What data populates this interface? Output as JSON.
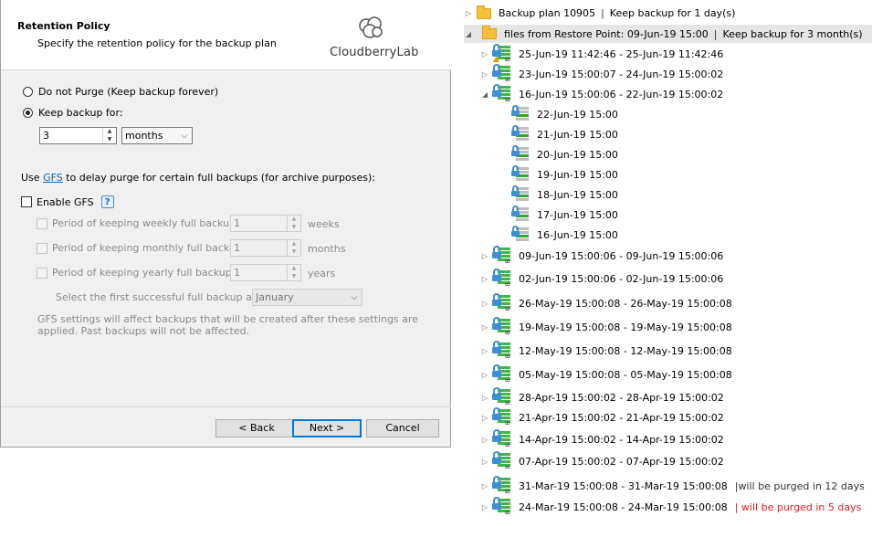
{
  "wizard": {
    "title": "Retention Policy",
    "subtitle": "Specify the retention policy for the backup plan",
    "logo_text": "CloudberryLab",
    "do_not_purge_label": "Do not Purge (Keep backup forever)",
    "keep_backup_label": "Keep backup for:",
    "keep_value": "3",
    "keep_unit": "months",
    "gfs_text_prefix": "Use",
    "gfs_link": "GFS",
    "gfs_text_suffix": "to delay purge for certain full backups (for archive purposes):",
    "enable_gfs_label": "Enable GFS",
    "help_glyph": "?",
    "weekly_label": "Period of keeping weekly full backups:",
    "weekly_value": "1",
    "weekly_unit": "weeks",
    "monthly_label": "Period of keeping monthly full backups:",
    "monthly_value": "1",
    "monthly_unit": "months",
    "yearly_label": "Period of keeping yearly full backups:",
    "yearly_value": "1",
    "yearly_unit": "years",
    "first_backup_label": "Select the first successful full backup as of:",
    "first_backup_value": "January",
    "note": "GFS settings will affect backups that will be created after these settings are applied. Past backups will not be affected.",
    "back_label": "< Back",
    "next_label": "Next >",
    "cancel_label": "Cancel"
  },
  "tree": {
    "plan": {
      "name": "Backup plan 10905",
      "keep": "Keep backup for 1 day(s)"
    },
    "restore_point": {
      "name": "files from Restore Point: 09-Jun-19 15:00",
      "keep": "Keep backup for 3 month(s)"
    },
    "ranges_top": [
      {
        "label": "25-Jun-19 11:42:46 - 25-Jun-19 11:42:46",
        "warn": true
      },
      {
        "label": "23-Jun-19 15:00:07 - 24-Jun-19 15:00:02"
      },
      {
        "label": "16-Jun-19 15:00:06 - 22-Jun-19 15:00:02"
      }
    ],
    "files": [
      {
        "label": "22-Jun-19 15:00"
      },
      {
        "label": "21-Jun-19 15:00"
      },
      {
        "label": "20-Jun-19 15:00"
      },
      {
        "label": "19-Jun-19 15:00"
      },
      {
        "label": "18-Jun-19 15:00"
      },
      {
        "label": "17-Jun-19 15:00"
      },
      {
        "label": "16-Jun-19 15:00"
      }
    ],
    "ranges_bottom": [
      {
        "label": "09-Jun-19 15:00:06 - 09-Jun-19 15:00:06"
      },
      {
        "label": "02-Jun-19 15:00:06 - 02-Jun-19 15:00:06"
      },
      {
        "label": "26-May-19 15:00:08 - 26-May-19 15:00:08"
      },
      {
        "label": "19-May-19 15:00:08 - 19-May-19 15:00:08"
      },
      {
        "label": "12-May-19 15:00:08 - 12-May-19 15:00:08"
      },
      {
        "label": "05-May-19 15:00:08 - 05-May-19 15:00:08"
      },
      {
        "label": "28-Apr-19 15:00:02 - 28-Apr-19 15:00:02"
      },
      {
        "label": "21-Apr-19 15:00:02 - 21-Apr-19 15:00:02"
      },
      {
        "label": "14-Apr-19 15:00:02 - 14-Apr-19 15:00:02"
      },
      {
        "label": "07-Apr-19 15:00:02 - 07-Apr-19 15:00:02"
      },
      {
        "label": "31-Mar-19 15:00:08 - 31-Mar-19 15:00:08",
        "purge": "|will be purged in 12 days"
      },
      {
        "label": "24-Mar-19 15:00:08 - 24-Mar-19 15:00:08",
        "purge_red": "| will be purged in 5 days"
      }
    ],
    "separator": "|",
    "expand_glyph": "▷",
    "collapse_glyph": "◢"
  },
  "colors": {
    "accent": "#0078d7",
    "link": "#0066cc",
    "warning_red": "#e02020",
    "bars_green": "#42b549"
  }
}
